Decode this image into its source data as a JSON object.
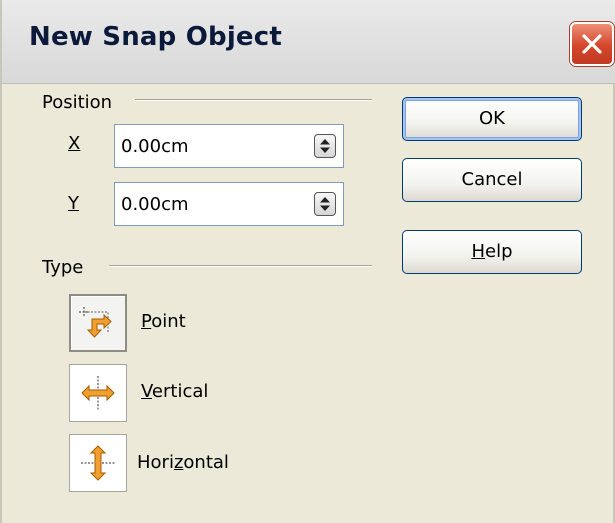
{
  "window": {
    "title": "New Snap Object"
  },
  "position": {
    "label": "Position",
    "x": {
      "label": "X",
      "value": "0.00cm"
    },
    "y": {
      "label": "Y",
      "value": "0.00cm"
    }
  },
  "type": {
    "label": "Type",
    "options": [
      {
        "key": "P",
        "rest": "oint",
        "full": "Point",
        "icon": "snap-point-icon",
        "selected": true
      },
      {
        "key": "V",
        "rest": "ertical",
        "full": "Vertical",
        "icon": "snap-vertical-icon",
        "selected": false
      },
      {
        "pre": "Hori",
        "key": "z",
        "rest": "ontal",
        "full": "Horizontal",
        "icon": "snap-horizontal-icon",
        "selected": false
      }
    ]
  },
  "buttons": {
    "ok": "OK",
    "cancel": "Cancel",
    "help_key": "H",
    "help_rest": "elp"
  },
  "colors": {
    "close": "#d3462c",
    "icon_orange": "#e08a1b",
    "focus_blue": "#7ba2e7"
  }
}
